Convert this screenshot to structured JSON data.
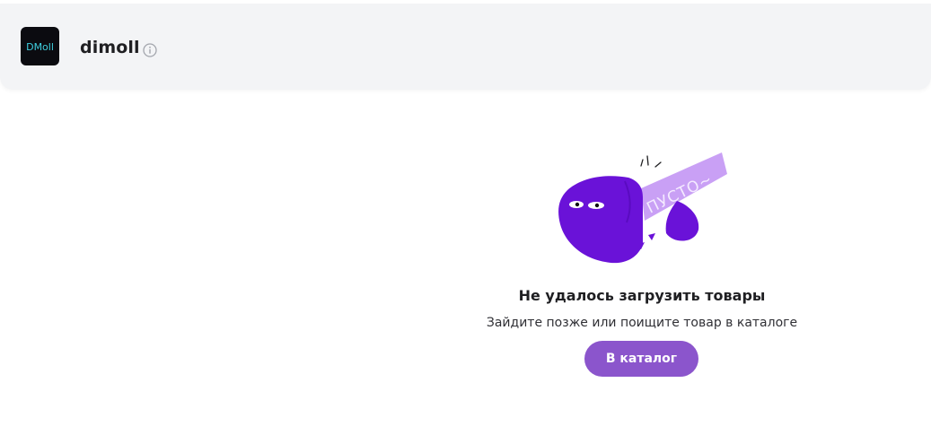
{
  "header": {
    "shop_name": "dimoll",
    "logo_text": "DMoll",
    "info_icon": "info-icon"
  },
  "illustration": {
    "label": "ПУСТО~"
  },
  "empty_state": {
    "title": "Не удалось загрузить товары",
    "subtitle": "Зайдите позже или поищите товар в каталоге",
    "button_label": "В каталог"
  },
  "colors": {
    "header_bg": "#f3f4f6",
    "accent": "#8b55cc",
    "blob": "#6a12d8",
    "paper": "#c9a0f5"
  }
}
